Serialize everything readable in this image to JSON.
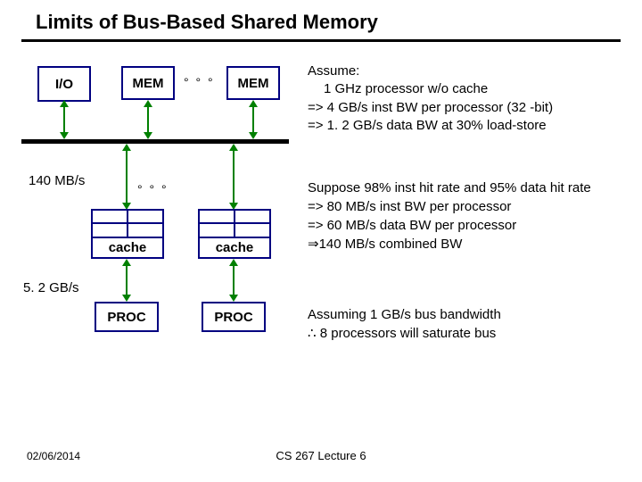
{
  "title": "Limits of Bus-Based Shared Memory",
  "diagram": {
    "io": "I/O",
    "mem": "MEM",
    "dots": "°  °  °",
    "cache": "cache",
    "proc": "PROC",
    "label_140": "140 MB/s",
    "label_52": "5. 2 GB/s"
  },
  "assume": {
    "head": "Assume:",
    "l1": "1 GHz processor w/o cache",
    "l2": "=> 4 GB/s inst BW per processor (32 -bit)",
    "l3": "=>  1. 2 GB/s data BW at 30% load-store"
  },
  "suppose": {
    "head": "Suppose 98% inst hit rate and 95% data hit rate",
    "l1": "=>  80 MB/s inst BW per processor",
    "l2": "=> 60 MB/s data BW per processor",
    "l3": "⇒140 MB/s combined BW"
  },
  "conclude": {
    "l1": "Assuming 1 GB/s bus bandwidth",
    "l2": "∴ 8 processors will saturate bus"
  },
  "footer": {
    "date": "02/06/2014",
    "center": "CS 267 Lecture 6"
  }
}
